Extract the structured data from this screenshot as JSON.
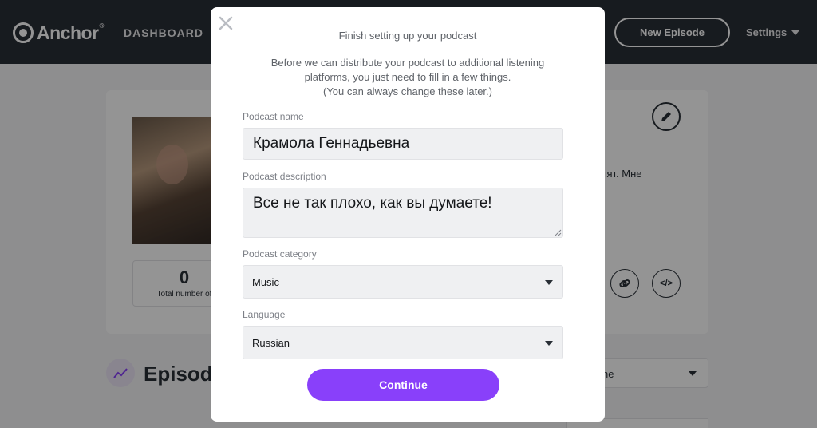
{
  "app": {
    "logo_text": "Anchor",
    "logo_reg": "®",
    "nav_dashboard": "DASHBOARD",
    "new_episode": "New Episode",
    "settings": "Settings"
  },
  "background": {
    "stat_value": "0",
    "stat_label": "Total number of",
    "description_fragment": "латят. Мне",
    "episodes_title": "Episod",
    "sort_fragment": "ne",
    "embed_glyph": "</>"
  },
  "modal": {
    "title": "Finish setting up your podcast",
    "intro_lines": [
      "Before we can distribute your podcast to additional listening",
      "platforms, you just need to fill in a few things.",
      "(You can always change these later.)"
    ],
    "name_label": "Podcast name",
    "name_value": "Крамола Геннадьевна",
    "description_label": "Podcast description",
    "description_value": "Все не так плохо, как вы думаете!",
    "category_label": "Podcast category",
    "category_value": "Music",
    "language_label": "Language",
    "language_value": "Russian",
    "continue_label": "Continue"
  },
  "colors": {
    "topbar": "#292f36",
    "accent": "#8940fa",
    "field_bg": "#eff0f2"
  },
  "icons": [
    "close-icon",
    "pencil-icon",
    "link-icon",
    "embed-code-icon",
    "chart-icon",
    "chevron-down-icon"
  ]
}
